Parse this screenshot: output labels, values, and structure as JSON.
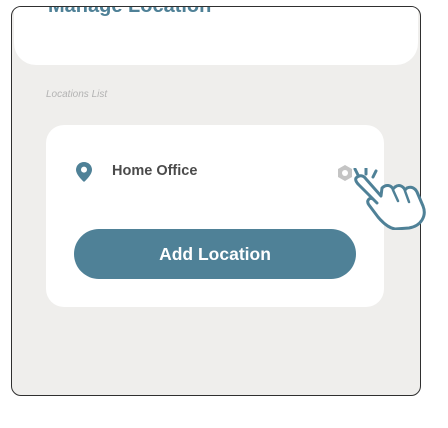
{
  "header": {
    "title": "Manage Location"
  },
  "locations": {
    "section_label": "Locations List",
    "items": [
      {
        "name": "Home Office",
        "icon": "map-pin-icon",
        "action_icon": "gear-icon"
      }
    ],
    "add_button_label": "Add Location"
  },
  "colors": {
    "accent": "#4f8197",
    "background": "#efeeec",
    "card": "#ffffff",
    "text": "#4b4b4b",
    "muted": "#b3b3b3"
  },
  "overlay": {
    "icon": "pointing-hand-icon"
  }
}
